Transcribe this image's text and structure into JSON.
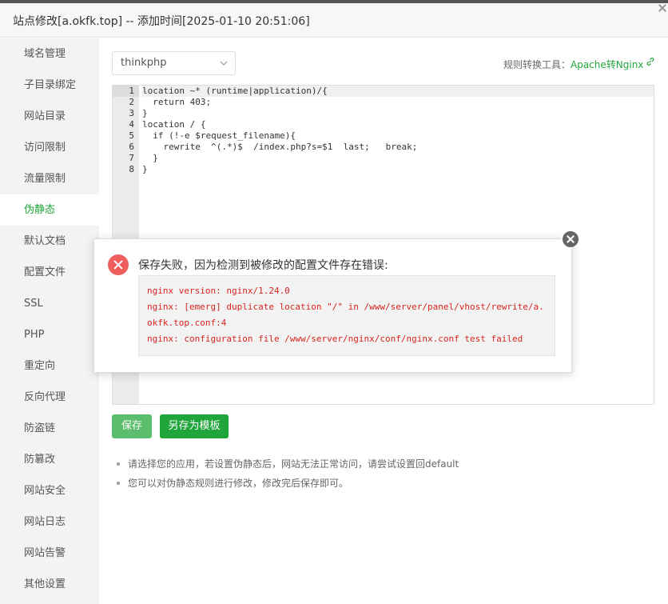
{
  "window": {
    "title": "站点修改[a.okfk.top] -- 添加时间[2025-01-10 20:51:06]"
  },
  "sidebar": {
    "items": [
      {
        "label": "域名管理"
      },
      {
        "label": "子目录绑定"
      },
      {
        "label": "网站目录"
      },
      {
        "label": "访问限制"
      },
      {
        "label": "流量限制"
      },
      {
        "label": "伪静态",
        "active": true
      },
      {
        "label": "默认文档"
      },
      {
        "label": "配置文件"
      },
      {
        "label": "SSL"
      },
      {
        "label": "PHP"
      },
      {
        "label": "重定向"
      },
      {
        "label": "反向代理"
      },
      {
        "label": "防盗链"
      },
      {
        "label": "防篡改"
      },
      {
        "label": "网站安全"
      },
      {
        "label": "网站日志"
      },
      {
        "label": "网站告警"
      },
      {
        "label": "其他设置"
      }
    ]
  },
  "rewrite": {
    "selected_template": "thinkphp",
    "tool_label": "规则转换工具：",
    "tool_link": "Apache转Nginx",
    "tool_icon": "link-icon"
  },
  "editor": {
    "line_numbers": [
      "1",
      "2",
      "3",
      "4",
      "5",
      "6",
      "7",
      "8"
    ],
    "lines": [
      "location ~* (runtime|application)/{",
      "  return 403;",
      "}",
      "location / {",
      "  if (!-e $request_filename){",
      "    rewrite  ^(.*)$  /index.php?s=$1  last;   break;",
      "  }",
      "}"
    ]
  },
  "buttons": {
    "save": "保存",
    "save_as_template": "另存为模板"
  },
  "tips": [
    "请选择您的应用，若设置伪静态后，网站无法正常访问，请尝试设置回default",
    "您可以对伪静态规则进行修改，修改完后保存即可。"
  ],
  "error_dialog": {
    "title": "保存失败，因为检测到被修改的配置文件存在错误:",
    "lines": [
      "nginx version: nginx/1.24.0",
      "nginx: [emerg] duplicate location \"/\" in /www/server/panel/vhost/rewrite/a.",
      "okfk.top.conf:4",
      "nginx: configuration file /www/server/nginx/conf/nginx.conf test failed"
    ],
    "icon": "error-icon",
    "close_icon": "close-icon"
  },
  "colors": {
    "accent": "#20a53a",
    "error": "#d9241f",
    "error_icon": "#f05d5d"
  }
}
